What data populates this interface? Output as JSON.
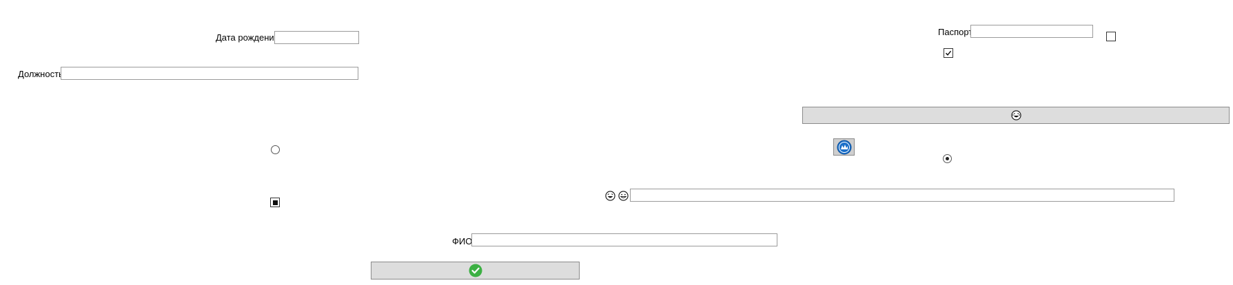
{
  "form": {
    "birth_date_label": "Дата рождения",
    "birth_date_value": "",
    "position_label": "Должность",
    "position_value": "",
    "passport_label": "Паспорт",
    "passport_value": "",
    "fio_label": "ФИО",
    "fio_value": "",
    "emoji_field_value": ""
  },
  "controls": {
    "top_right_checkbox_checked": false,
    "checkmark_checkbox_checked": true,
    "left_radio_selected": false,
    "right_radio_selected": true,
    "filled_checkbox_state": "indeterminate"
  },
  "icons": {
    "wide_button_icon": "laughing-face-icon",
    "small_button_icon": "blue-round-badge-icon",
    "emoji_row_icons": [
      "laughing-face-icon",
      "grinning-face-icon"
    ],
    "ok_button_icon": "green-check-circle-icon"
  },
  "colors": {
    "button_background": "#dddddd",
    "field_border": "#9a9a9a",
    "check_green": "#3cb043",
    "badge_blue": "#1a6fc9"
  }
}
